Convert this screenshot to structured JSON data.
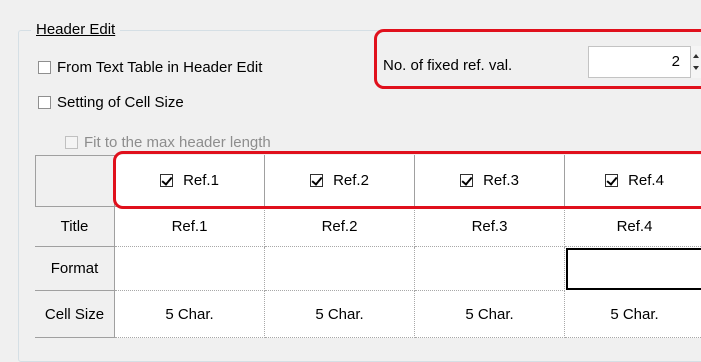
{
  "group": {
    "title": "Header Edit"
  },
  "options": {
    "from_text_table": {
      "label": "From Text Table in Header Edit",
      "checked": false
    },
    "setting_cell_size": {
      "label": "Setting of Cell Size",
      "checked": false
    },
    "fit_max_header": {
      "label": "Fit to the max header length",
      "checked": false,
      "enabled": false
    }
  },
  "fixed_ref": {
    "label": "No. of fixed ref. val.",
    "value": "2"
  },
  "grid": {
    "columns": [
      {
        "label": "Ref.1",
        "checked": true
      },
      {
        "label": "Ref.2",
        "checked": true
      },
      {
        "label": "Ref.3",
        "checked": true
      },
      {
        "label": "Ref.4",
        "checked": true
      }
    ],
    "rows": [
      {
        "header": "Title",
        "cells": [
          "Ref.1",
          "Ref.2",
          "Ref.3",
          "Ref.4"
        ]
      },
      {
        "header": "Format",
        "cells": [
          "",
          "",
          "",
          ""
        ]
      },
      {
        "header": "Cell Size",
        "cells": [
          "5 Char.",
          "5 Char.",
          "5 Char.",
          "5 Char."
        ]
      }
    ]
  },
  "colors": {
    "highlight": "#e0101c"
  }
}
